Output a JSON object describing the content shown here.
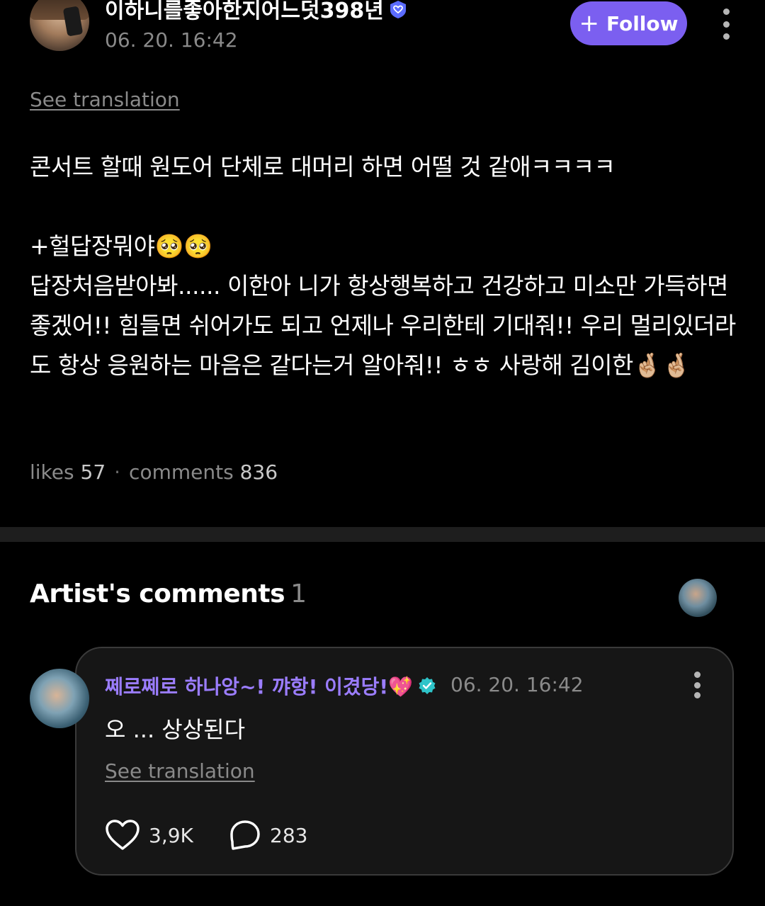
{
  "post": {
    "author": {
      "name": "이하니를좋아한지어느덧398년",
      "avatar_icon": "user-avatar-icon",
      "verified_icon": "heart-badge-icon",
      "badge_color": "#5b6cff"
    },
    "timestamp": "06. 20. 16:42",
    "follow_label": "Follow",
    "follow_icon": "plus-icon",
    "accent_color": "#7b5ff0",
    "see_translation": "See translation",
    "body": "콘서트 할때 원도어 단체로 대머리 하면 어떨 것 같애ㅋㅋㅋㅋ\n\n+헐답장뭐야🥺🥺\n답장처음받아봐...... 이한아 니가 항상행복하고 건강하고 미소만 가득하면 좋겠어!! 힘들면 쉬어가도 되고 언제나 우리한테 기대줘!! 우리 멀리있더라도 항상 응원하는 마음은 같다는거 알아줘!! ㅎㅎ 사랑해 김이한🤞🏼🤞🏼",
    "stats": {
      "likes_label": "likes",
      "likes_count": "57",
      "separator": "·",
      "comments_label": "comments",
      "comments_count": "836"
    }
  },
  "artist_comments": {
    "title": "Artist's comments",
    "count": "1",
    "comment": {
      "author": "쩨로쩨로 하나앙~! 꺄항! 이겼당!💖",
      "author_color": "#9b7dff",
      "verified_color": "#2ec4c9",
      "timestamp": "06. 20. 16:42",
      "text": "오 ... 상상된다",
      "see_translation": "See translation",
      "likes": "3,9K",
      "replies": "283"
    }
  }
}
